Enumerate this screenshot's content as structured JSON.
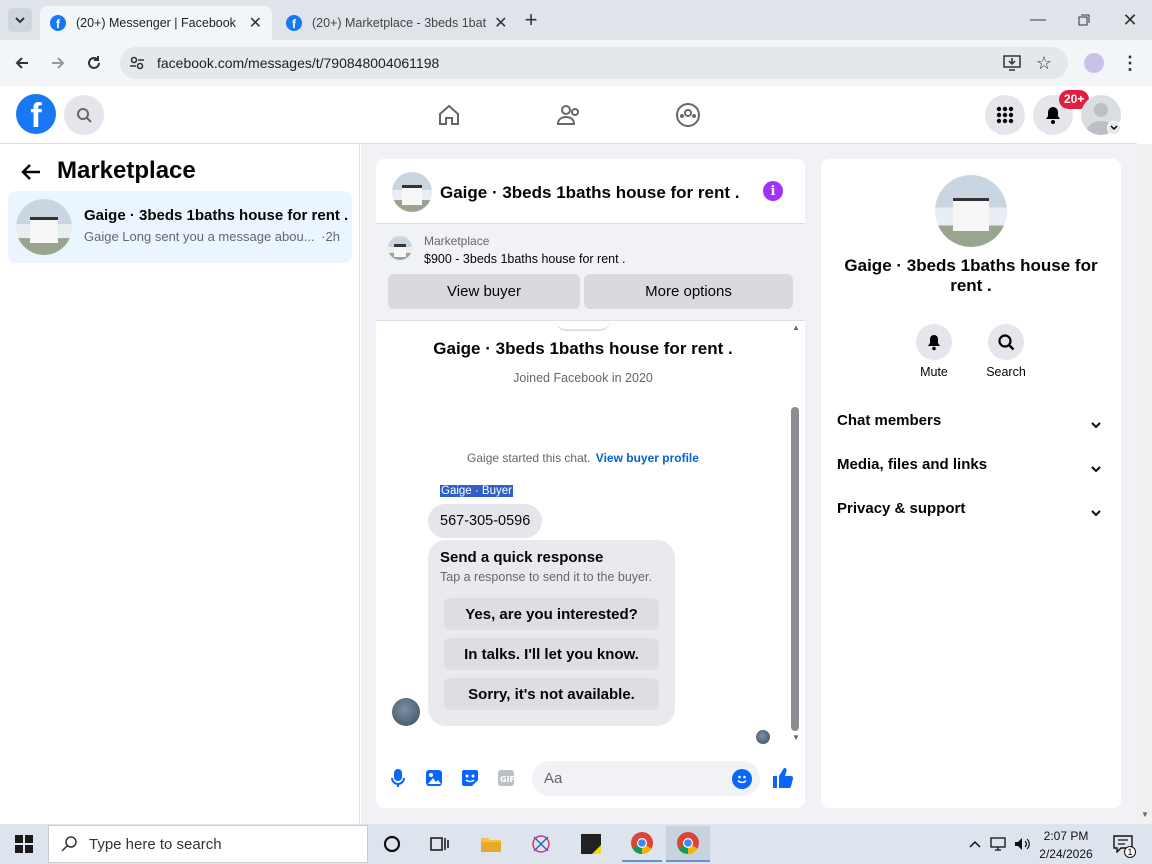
{
  "browser": {
    "tabs": [
      {
        "title": "(20+) Messenger | Facebook",
        "active": true
      },
      {
        "title": "(20+) Marketplace - 3beds 1bat",
        "active": false
      }
    ],
    "new_tab": "+",
    "url": "facebook.com/messages/t/790848004061198"
  },
  "fb": {
    "logo": "f",
    "notifications_badge": "20+"
  },
  "sidebar": {
    "title": "Marketplace",
    "thread": {
      "name": "Gaige · 3beds 1baths house for rent .",
      "preview": "Gaige Long sent you a message abou...",
      "time": "·2h"
    }
  },
  "chat": {
    "header_name": "Gaige · 3beds 1baths house for rent .",
    "listing_label": "Marketplace",
    "listing_title": "$900 - 3beds 1baths house for rent .",
    "view_buyer": "View buyer",
    "more_options": "More options",
    "profile_name": "Gaige · 3beds 1baths house for rent .",
    "joined": "Joined Facebook in 2020",
    "started_text": "Gaige started this chat.",
    "view_buyer_profile": "View buyer profile",
    "sender_label": "Gaige · Buyer",
    "phone_message": "567-305-0596",
    "quick_title": "Send a quick response",
    "quick_sub": "Tap a response to send it to the buyer.",
    "replies": [
      "Yes, are you interested?",
      "In talks. I'll let you know.",
      "Sorry, it's not available."
    ],
    "input_placeholder": "Aa"
  },
  "right": {
    "name": "Gaige · 3beds 1baths house for rent .",
    "mute": "Mute",
    "search": "Search",
    "sections": [
      "Chat members",
      "Media, files and links",
      "Privacy & support"
    ]
  },
  "taskbar": {
    "search_placeholder": "Type here to search",
    "time": "2:07 PM",
    "date": "2/24/2026",
    "notification_count": "1"
  },
  "colors": {
    "brand": "#1877f2",
    "info": "#a033ff",
    "badge": "#e41e3f",
    "link": "#0064d1"
  }
}
